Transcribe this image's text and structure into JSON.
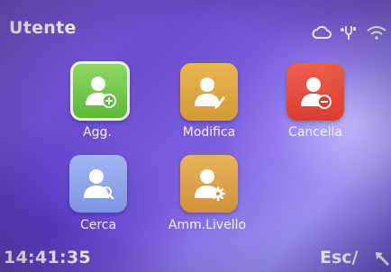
{
  "header": {
    "title": "Utente",
    "status_icons": [
      "cloud-icon",
      "usb-icon",
      "wifi-icon"
    ]
  },
  "menu": {
    "items": [
      {
        "label": "Agg.",
        "icon": "user-add-icon",
        "color": "#6cc247",
        "selected": true
      },
      {
        "label": "Modifica",
        "icon": "user-edit-icon",
        "color": "#dda23c",
        "selected": false
      },
      {
        "label": "Cancella",
        "icon": "user-delete-icon",
        "color": "#e44a3a",
        "selected": false
      },
      {
        "label": "Cerca",
        "icon": "user-search-icon",
        "color": "#8ca4ea",
        "selected": false
      },
      {
        "label": "Amm.Livello",
        "icon": "user-admin-icon",
        "color": "#dba043",
        "selected": false
      }
    ]
  },
  "footer": {
    "time": "14:41:35",
    "esc_label": "Esc/",
    "back_icon": "back-arrow-icon"
  },
  "colors": {
    "background": "#7a5bd6",
    "text": "#ffffff"
  }
}
